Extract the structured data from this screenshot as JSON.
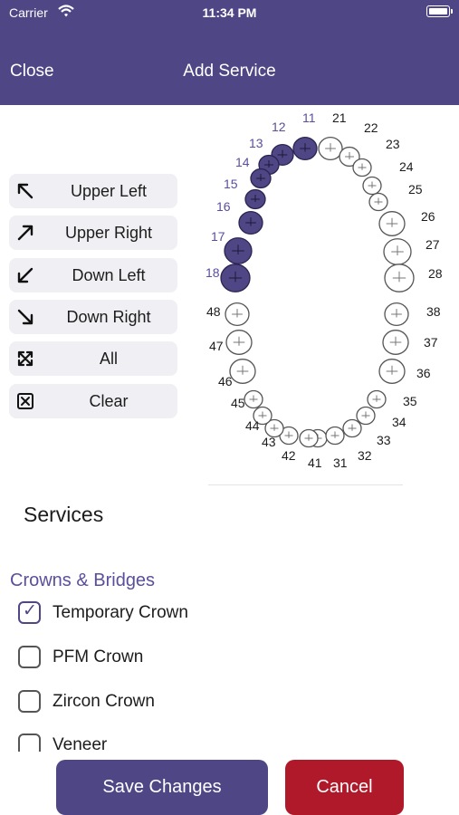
{
  "status_bar": {
    "carrier": "Carrier",
    "time": "11:34 PM"
  },
  "header": {
    "close_label": "Close",
    "title": "Add Service"
  },
  "quadrant_buttons": [
    {
      "label": "Upper Left",
      "icon": "arrow-up-left-icon"
    },
    {
      "label": "Upper Right",
      "icon": "arrow-up-right-icon"
    },
    {
      "label": "Down Left",
      "icon": "arrow-down-left-icon"
    },
    {
      "label": "Down Right",
      "icon": "arrow-down-right-icon"
    },
    {
      "label": "All",
      "icon": "expand-all-icon"
    },
    {
      "label": "Clear",
      "icon": "clear-box-icon"
    }
  ],
  "tooth_chart": {
    "selected_color": "#4f4785",
    "upper_right_numbers": [
      "11",
      "12",
      "13",
      "14",
      "15",
      "16",
      "17",
      "18"
    ],
    "upper_left_numbers": [
      "21",
      "22",
      "23",
      "24",
      "25",
      "26",
      "27",
      "28"
    ],
    "lower_left_numbers": [
      "31",
      "32",
      "33",
      "34",
      "35",
      "36",
      "37",
      "38"
    ],
    "lower_right_numbers": [
      "41",
      "42",
      "43",
      "44",
      "45",
      "46",
      "47",
      "48"
    ],
    "selected_teeth": [
      "11",
      "12",
      "13",
      "14",
      "15",
      "16",
      "17",
      "18"
    ]
  },
  "services": {
    "title": "Services",
    "category": "Crowns & Bridges",
    "items": [
      {
        "label": "Temporary Crown",
        "checked": true
      },
      {
        "label": "PFM Crown",
        "checked": false
      },
      {
        "label": "Zircon Crown",
        "checked": false
      },
      {
        "label": "Veneer",
        "checked": false
      }
    ]
  },
  "actions": {
    "save_label": "Save Changes",
    "cancel_label": "Cancel"
  },
  "colors": {
    "header": "#4f4785",
    "cancel": "#b0192a",
    "accent": "#5a4f9c"
  }
}
